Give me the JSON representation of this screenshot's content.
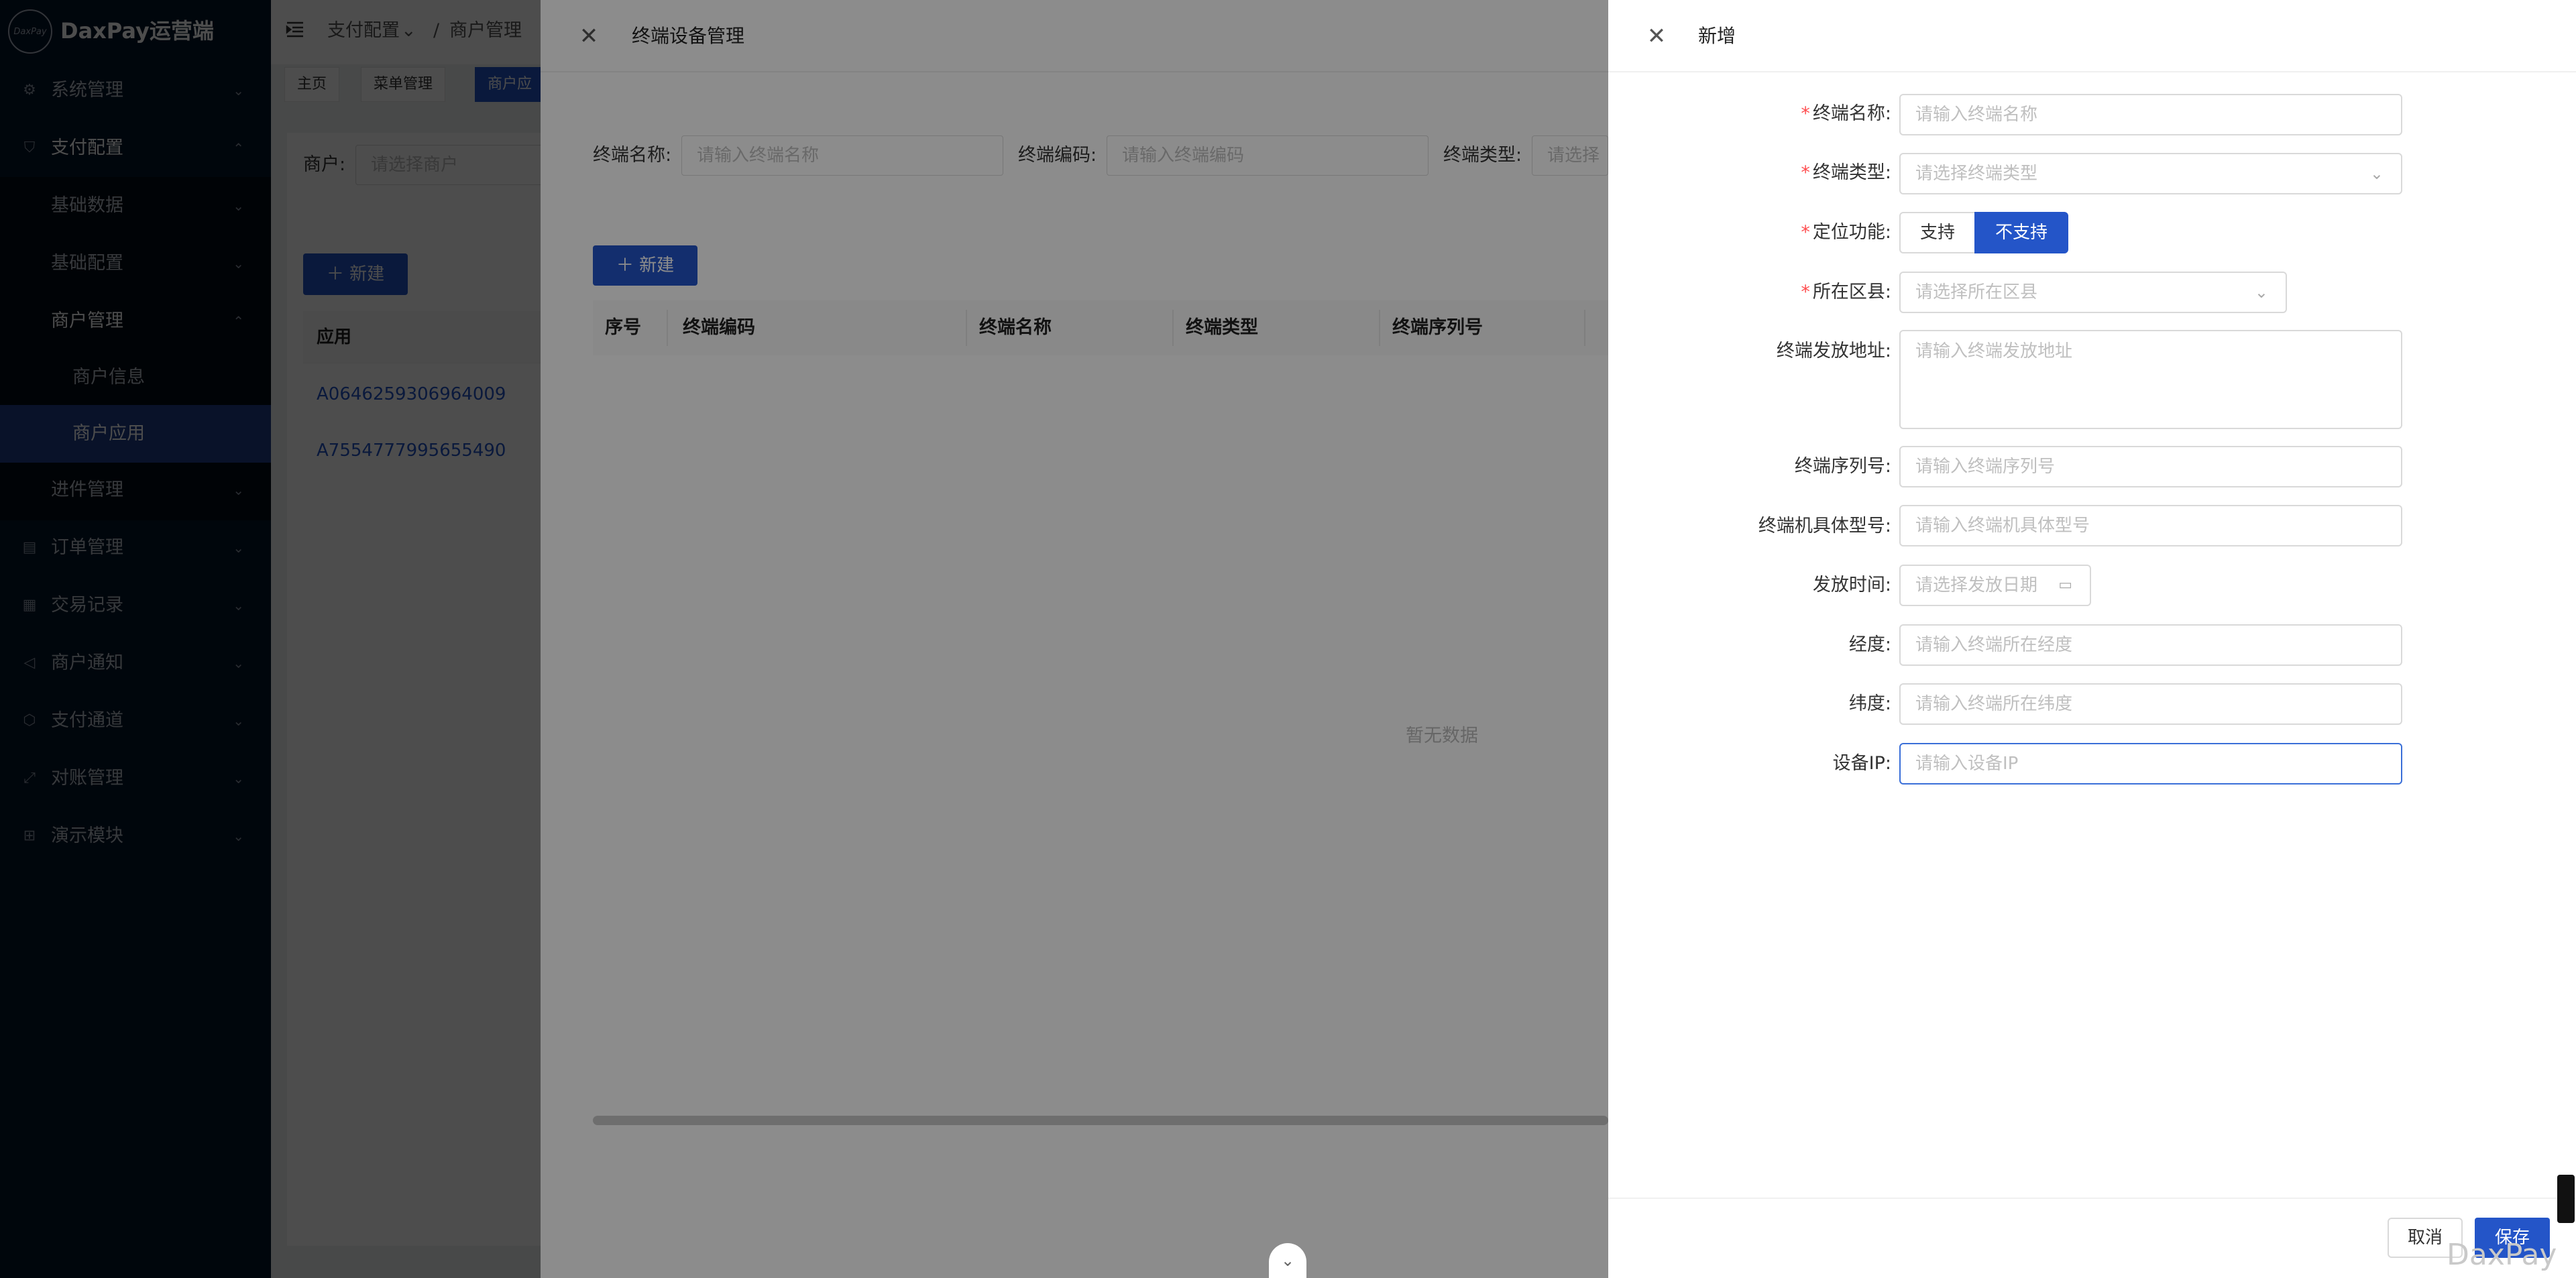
{
  "app": {
    "logo_badge": "DaxPay",
    "title": "DaxPay运营端"
  },
  "sidebar": {
    "items": [
      {
        "label": "系统管理",
        "icon": "gear-icon"
      },
      {
        "label": "支付配置",
        "icon": "shield-icon"
      },
      {
        "label": "基础数据"
      },
      {
        "label": "基础配置"
      },
      {
        "label": "商户管理"
      },
      {
        "label": "商户信息"
      },
      {
        "label": "商户应用"
      },
      {
        "label": "进件管理"
      },
      {
        "label": "订单管理",
        "icon": "order-icon"
      },
      {
        "label": "交易记录",
        "icon": "record-icon"
      },
      {
        "label": "商户通知",
        "icon": "notify-icon"
      },
      {
        "label": "支付通道",
        "icon": "channel-icon"
      },
      {
        "label": "对账管理",
        "icon": "reconcile-icon"
      },
      {
        "label": "演示模块",
        "icon": "grid-icon"
      }
    ]
  },
  "header": {
    "breadcrumb_1": "支付配置",
    "breadcrumb_sep": "/",
    "breadcrumb_2": "商户管理"
  },
  "tabs": [
    {
      "label": "主页"
    },
    {
      "label": "菜单管理"
    },
    {
      "label": "商户应"
    }
  ],
  "content": {
    "merchant_label": "商户:",
    "merchant_placeholder": "请选择商户",
    "new_button": "新建",
    "col_app": "应用",
    "rows": [
      "A0646259306964009",
      "A7554777995655490"
    ]
  },
  "terminal_drawer": {
    "title": "终端设备管理",
    "search": {
      "name_label": "终端名称:",
      "name_placeholder": "请输入终端名称",
      "code_label": "终端编码:",
      "code_placeholder": "请输入终端编码",
      "type_label": "终端类型:",
      "type_placeholder": "请选择"
    },
    "new_button": "新建",
    "columns": [
      "序号",
      "终端编码",
      "终端名称",
      "终端类型",
      "终端序列号"
    ],
    "empty_text": "暂无数据"
  },
  "form_drawer": {
    "title": "新增",
    "fields": {
      "name": {
        "label": "终端名称:",
        "placeholder": "请输入终端名称"
      },
      "type": {
        "label": "终端类型:",
        "placeholder": "请选择终端类型"
      },
      "location": {
        "label": "定位功能:",
        "options": [
          "支持",
          "不支持"
        ],
        "selected": "不支持"
      },
      "district": {
        "label": "所在区县:",
        "placeholder": "请选择所在区县"
      },
      "address": {
        "label": "终端发放地址:",
        "placeholder": "请输入终端发放地址"
      },
      "serial": {
        "label": "终端序列号:",
        "placeholder": "请输入终端序列号"
      },
      "model": {
        "label": "终端机具体型号:",
        "placeholder": "请输入终端机具体型号"
      },
      "issue_time": {
        "label": "发放时间:",
        "placeholder": "请选择发放日期"
      },
      "longitude": {
        "label": "经度:",
        "placeholder": "请输入终端所在经度"
      },
      "latitude": {
        "label": "纬度:",
        "placeholder": "请输入终端所在纬度"
      },
      "ip": {
        "label": "设备IP:",
        "placeholder": "请输入设备IP"
      }
    },
    "cancel_button": "取消",
    "save_button": "保存"
  },
  "watermark": "DaxPay",
  "colors": {
    "primary": "#2455c8",
    "sidebar_bg": "#001529",
    "required": "#ff4d4f"
  }
}
